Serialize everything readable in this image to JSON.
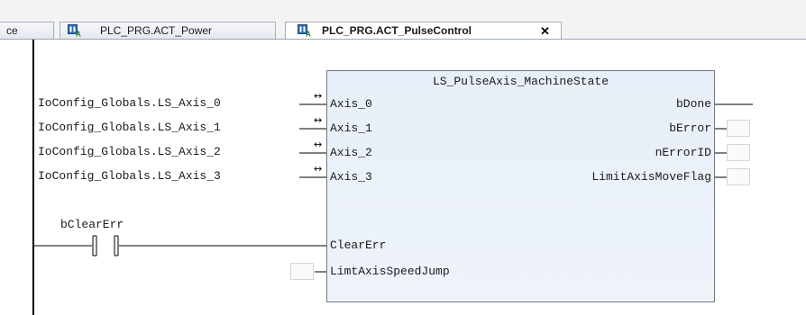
{
  "tabs": [
    {
      "label": "ce",
      "active": false
    },
    {
      "label": "PLC_PRG.ACT_Power",
      "active": false,
      "icon": "action-icon"
    },
    {
      "label": "PLC_PRG.ACT_PulseControl",
      "active": true,
      "icon": "action-icon",
      "close": "✕"
    }
  ],
  "block": {
    "type_name": "LS_PulseAxis_MachineState",
    "inputs": [
      "Axis_0",
      "Axis_1",
      "Axis_2",
      "Axis_3",
      "ClearErr",
      "LimtAxisSpeedJump"
    ],
    "outputs": [
      "bDone",
      "bError",
      "nErrorID",
      "LimitAxisMoveFlag"
    ]
  },
  "input_vars": [
    "IoConfig_Globals.LS_Axis_0",
    "IoConfig_Globals.LS_Axis_1",
    "IoConfig_Globals.LS_Axis_2",
    "IoConfig_Globals.LS_Axis_3"
  ],
  "contact": {
    "variable": "bClearErr"
  },
  "inout_arrow": "↔",
  "colors": {
    "block_fill": "#e8eff8",
    "block_border": "#6c7a8c",
    "wire": "#000000"
  }
}
